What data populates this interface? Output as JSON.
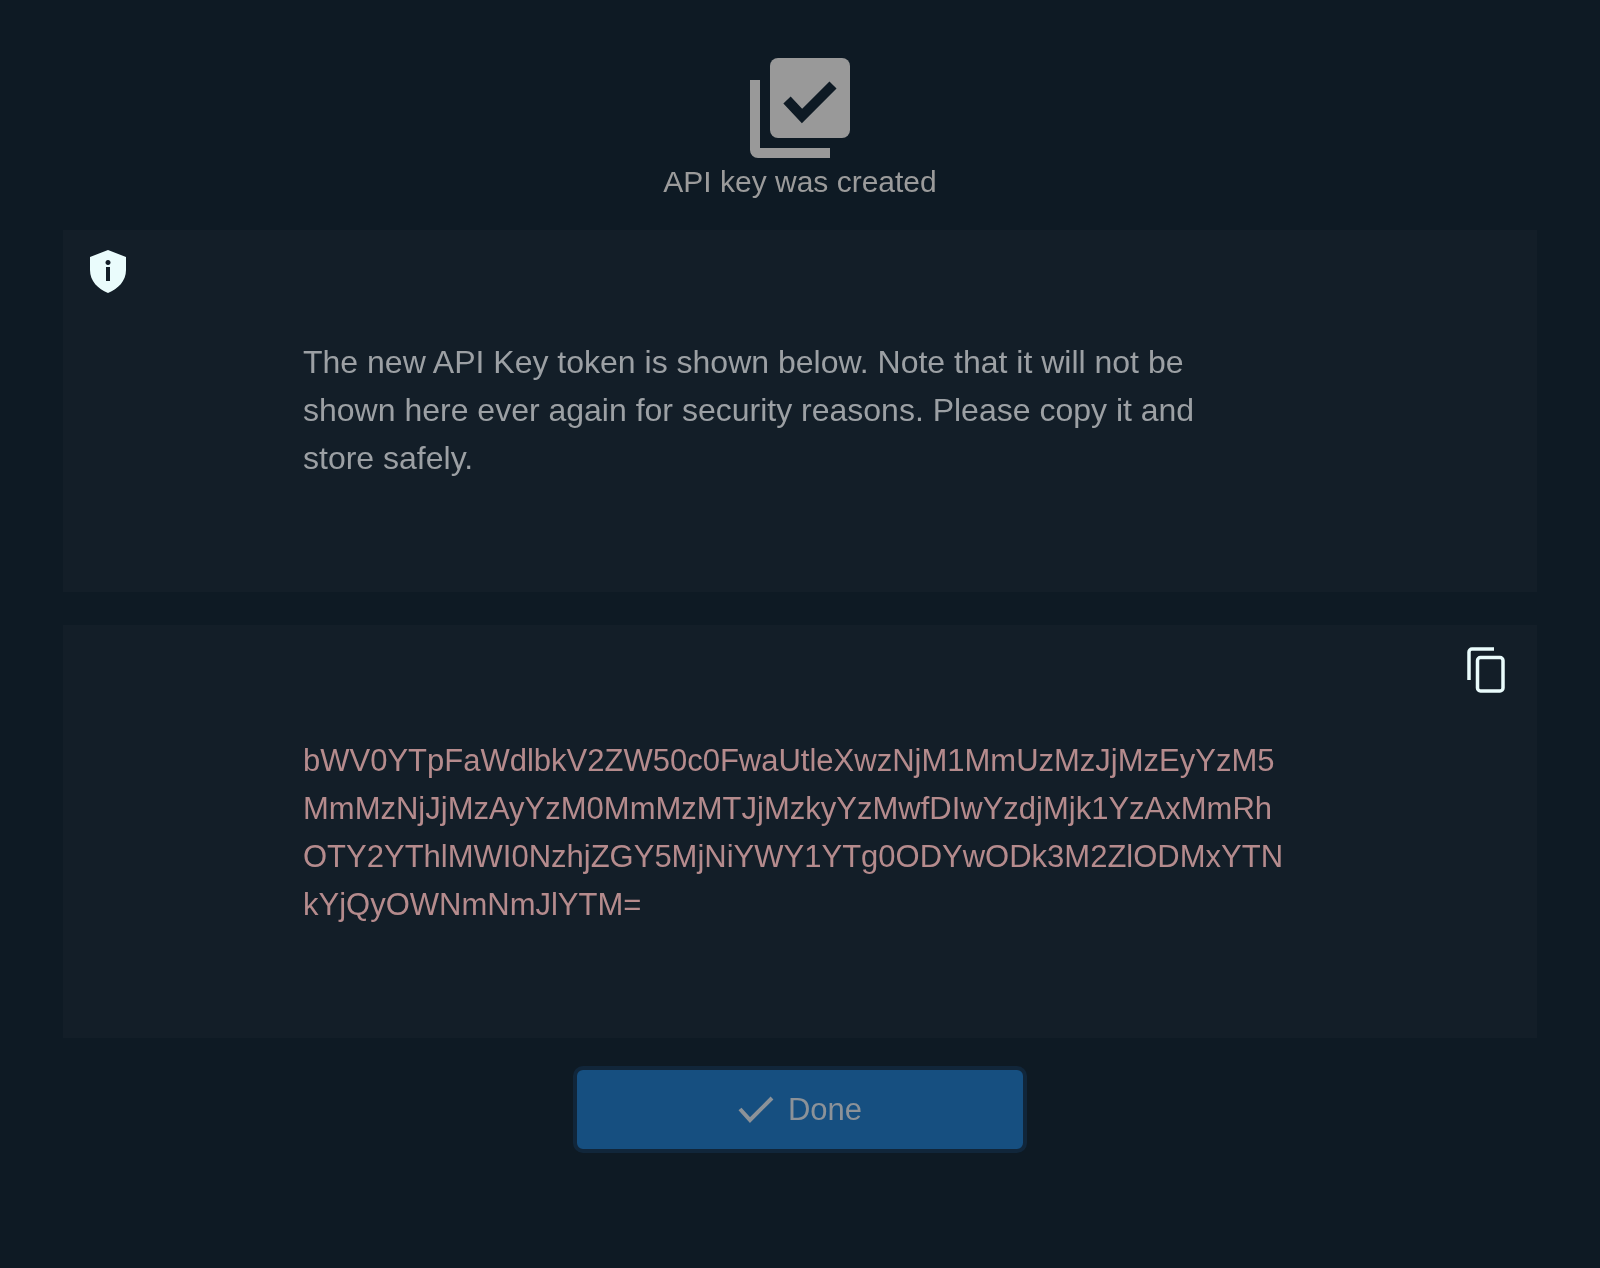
{
  "header": {
    "title": "API key was created"
  },
  "notice": {
    "message": "The new API Key token is shown below. Note that it will not be shown here ever again for security reasons. Please copy it and store safely."
  },
  "token": {
    "value": "bWV0YTpFaWdlbkV2ZW50c0FwaUtleXwzNjM1MmUzMzJjMzEyYzM5MmMzNjJjMzAyYzM0MmMzMTJjMzkyYzMwfDIwYzdjMjk1YzAxMmRhOTY2YThlMWI0NzhjZGY5MjNiYWY1YTg0ODYwODk3M2ZlODMxYTNkYjQyOWNmNmJlYTM="
  },
  "done_button": {
    "label": "Done"
  }
}
